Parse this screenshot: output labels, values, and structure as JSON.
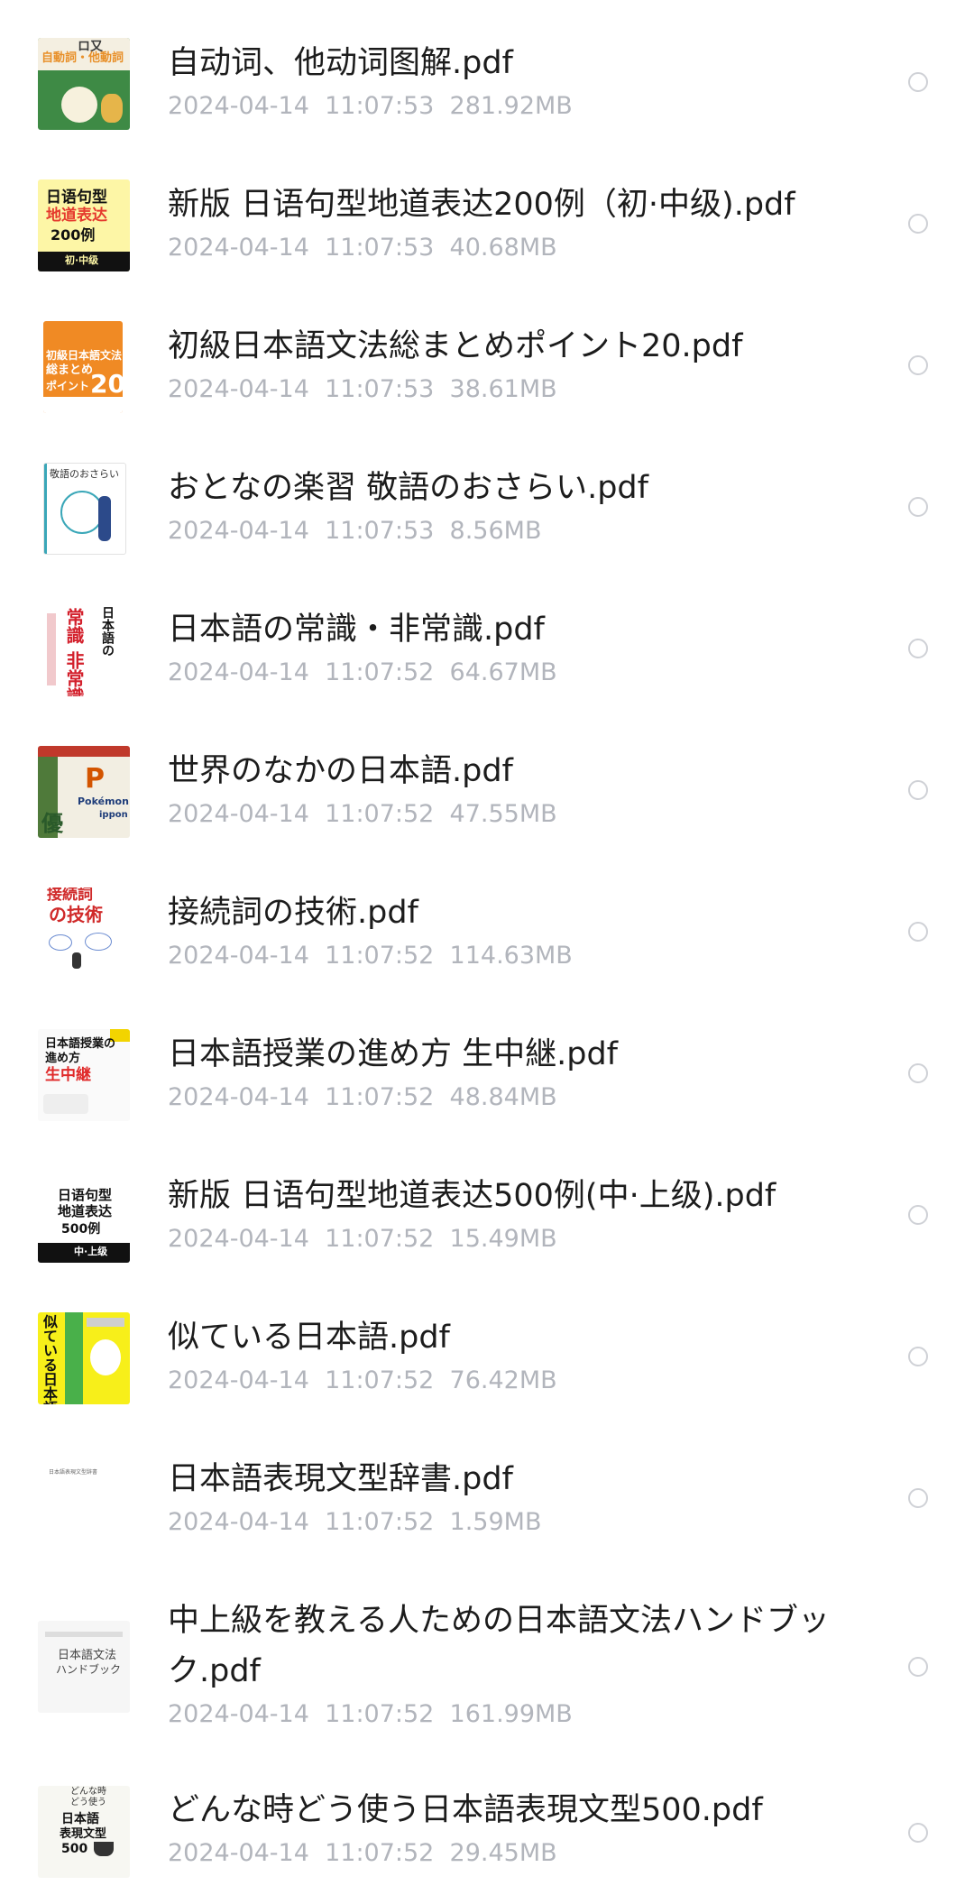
{
  "files": [
    {
      "name": "自动词、他动词图解.pdf",
      "date": "2024-04-14",
      "time": "11:07:53",
      "size": "281.92MB",
      "cover": {
        "icon": "book-cover-icon",
        "text_lines": [
          "ロ又",
          "自動詞・他動詞"
        ]
      }
    },
    {
      "name": "新版 日语句型地道表达200例（初·中级).pdf",
      "date": "2024-04-14",
      "time": "11:07:53",
      "size": "40.68MB",
      "cover": {
        "icon": "book-cover-icon",
        "text_lines": [
          "日语句型",
          "地道表达",
          "200例",
          "初·中级"
        ]
      }
    },
    {
      "name": "初級日本語文法総まとめポイント20.pdf",
      "date": "2024-04-14",
      "time": "11:07:53",
      "size": "38.61MB",
      "cover": {
        "icon": "book-cover-icon",
        "text_lines": [
          "初級日本語文法",
          "総まとめ",
          "ポイント",
          "20"
        ]
      }
    },
    {
      "name": "おとなの楽習 敬語のおさらい.pdf",
      "date": "2024-04-14",
      "time": "11:07:53",
      "size": "8.56MB",
      "cover": {
        "icon": "book-cover-icon",
        "text_lines": [
          "敬語のおさらい"
        ]
      }
    },
    {
      "name": "日本語の常識・非常識.pdf",
      "date": "2024-04-14",
      "time": "11:07:52",
      "size": "64.67MB",
      "cover": {
        "icon": "book-cover-icon",
        "text_lines": [
          "日本語の",
          "常識",
          "非常識"
        ]
      }
    },
    {
      "name": "世界のなかの日本語.pdf",
      "date": "2024-04-14",
      "time": "11:07:52",
      "size": "47.55MB",
      "cover": {
        "icon": "book-cover-icon",
        "text_lines": [
          "P",
          "Pokémon",
          "ippon",
          "優"
        ]
      }
    },
    {
      "name": "接続詞の技術.pdf",
      "date": "2024-04-14",
      "time": "11:07:52",
      "size": "114.63MB",
      "cover": {
        "icon": "book-cover-icon",
        "text_lines": [
          "接続詞",
          "の技術"
        ]
      }
    },
    {
      "name": "日本語授業の進め方 生中継.pdf",
      "date": "2024-04-14",
      "time": "11:07:52",
      "size": "48.84MB",
      "cover": {
        "icon": "book-cover-icon",
        "text_lines": [
          "日本語授業の",
          "進め方",
          "生中継"
        ]
      }
    },
    {
      "name": "新版 日语句型地道表达500例(中·上级).pdf",
      "date": "2024-04-14",
      "time": "11:07:52",
      "size": "15.49MB",
      "cover": {
        "icon": "book-cover-icon",
        "text_lines": [
          "日语句型",
          "地道表达",
          "500例",
          "中·上级"
        ]
      }
    },
    {
      "name": "似ている日本語.pdf",
      "date": "2024-04-14",
      "time": "11:07:52",
      "size": "76.42MB",
      "cover": {
        "icon": "book-cover-icon",
        "text_lines": [
          "似ている日本語"
        ]
      }
    },
    {
      "name": "日本語表現文型辞書.pdf",
      "date": "2024-04-14",
      "time": "11:07:52",
      "size": "1.59MB",
      "cover": {
        "icon": "book-cover-icon",
        "text_lines": [
          "日本語表現文型辞書"
        ]
      }
    },
    {
      "name": "中上級を教える人ための日本語文法ハンドブック.pdf",
      "date": "2024-04-14",
      "time": "11:07:52",
      "size": "161.99MB",
      "cover": {
        "icon": "book-cover-icon",
        "text_lines": [
          "日本語文法",
          "ハンドブック"
        ]
      }
    },
    {
      "name": "どんな時どう使う日本語表現文型500.pdf",
      "date": "2024-04-14",
      "time": "11:07:52",
      "size": "29.45MB",
      "cover": {
        "icon": "book-cover-icon",
        "text_lines": [
          "どんな時",
          "どう使う",
          "日本語",
          "表現文型",
          "500"
        ]
      }
    }
  ]
}
